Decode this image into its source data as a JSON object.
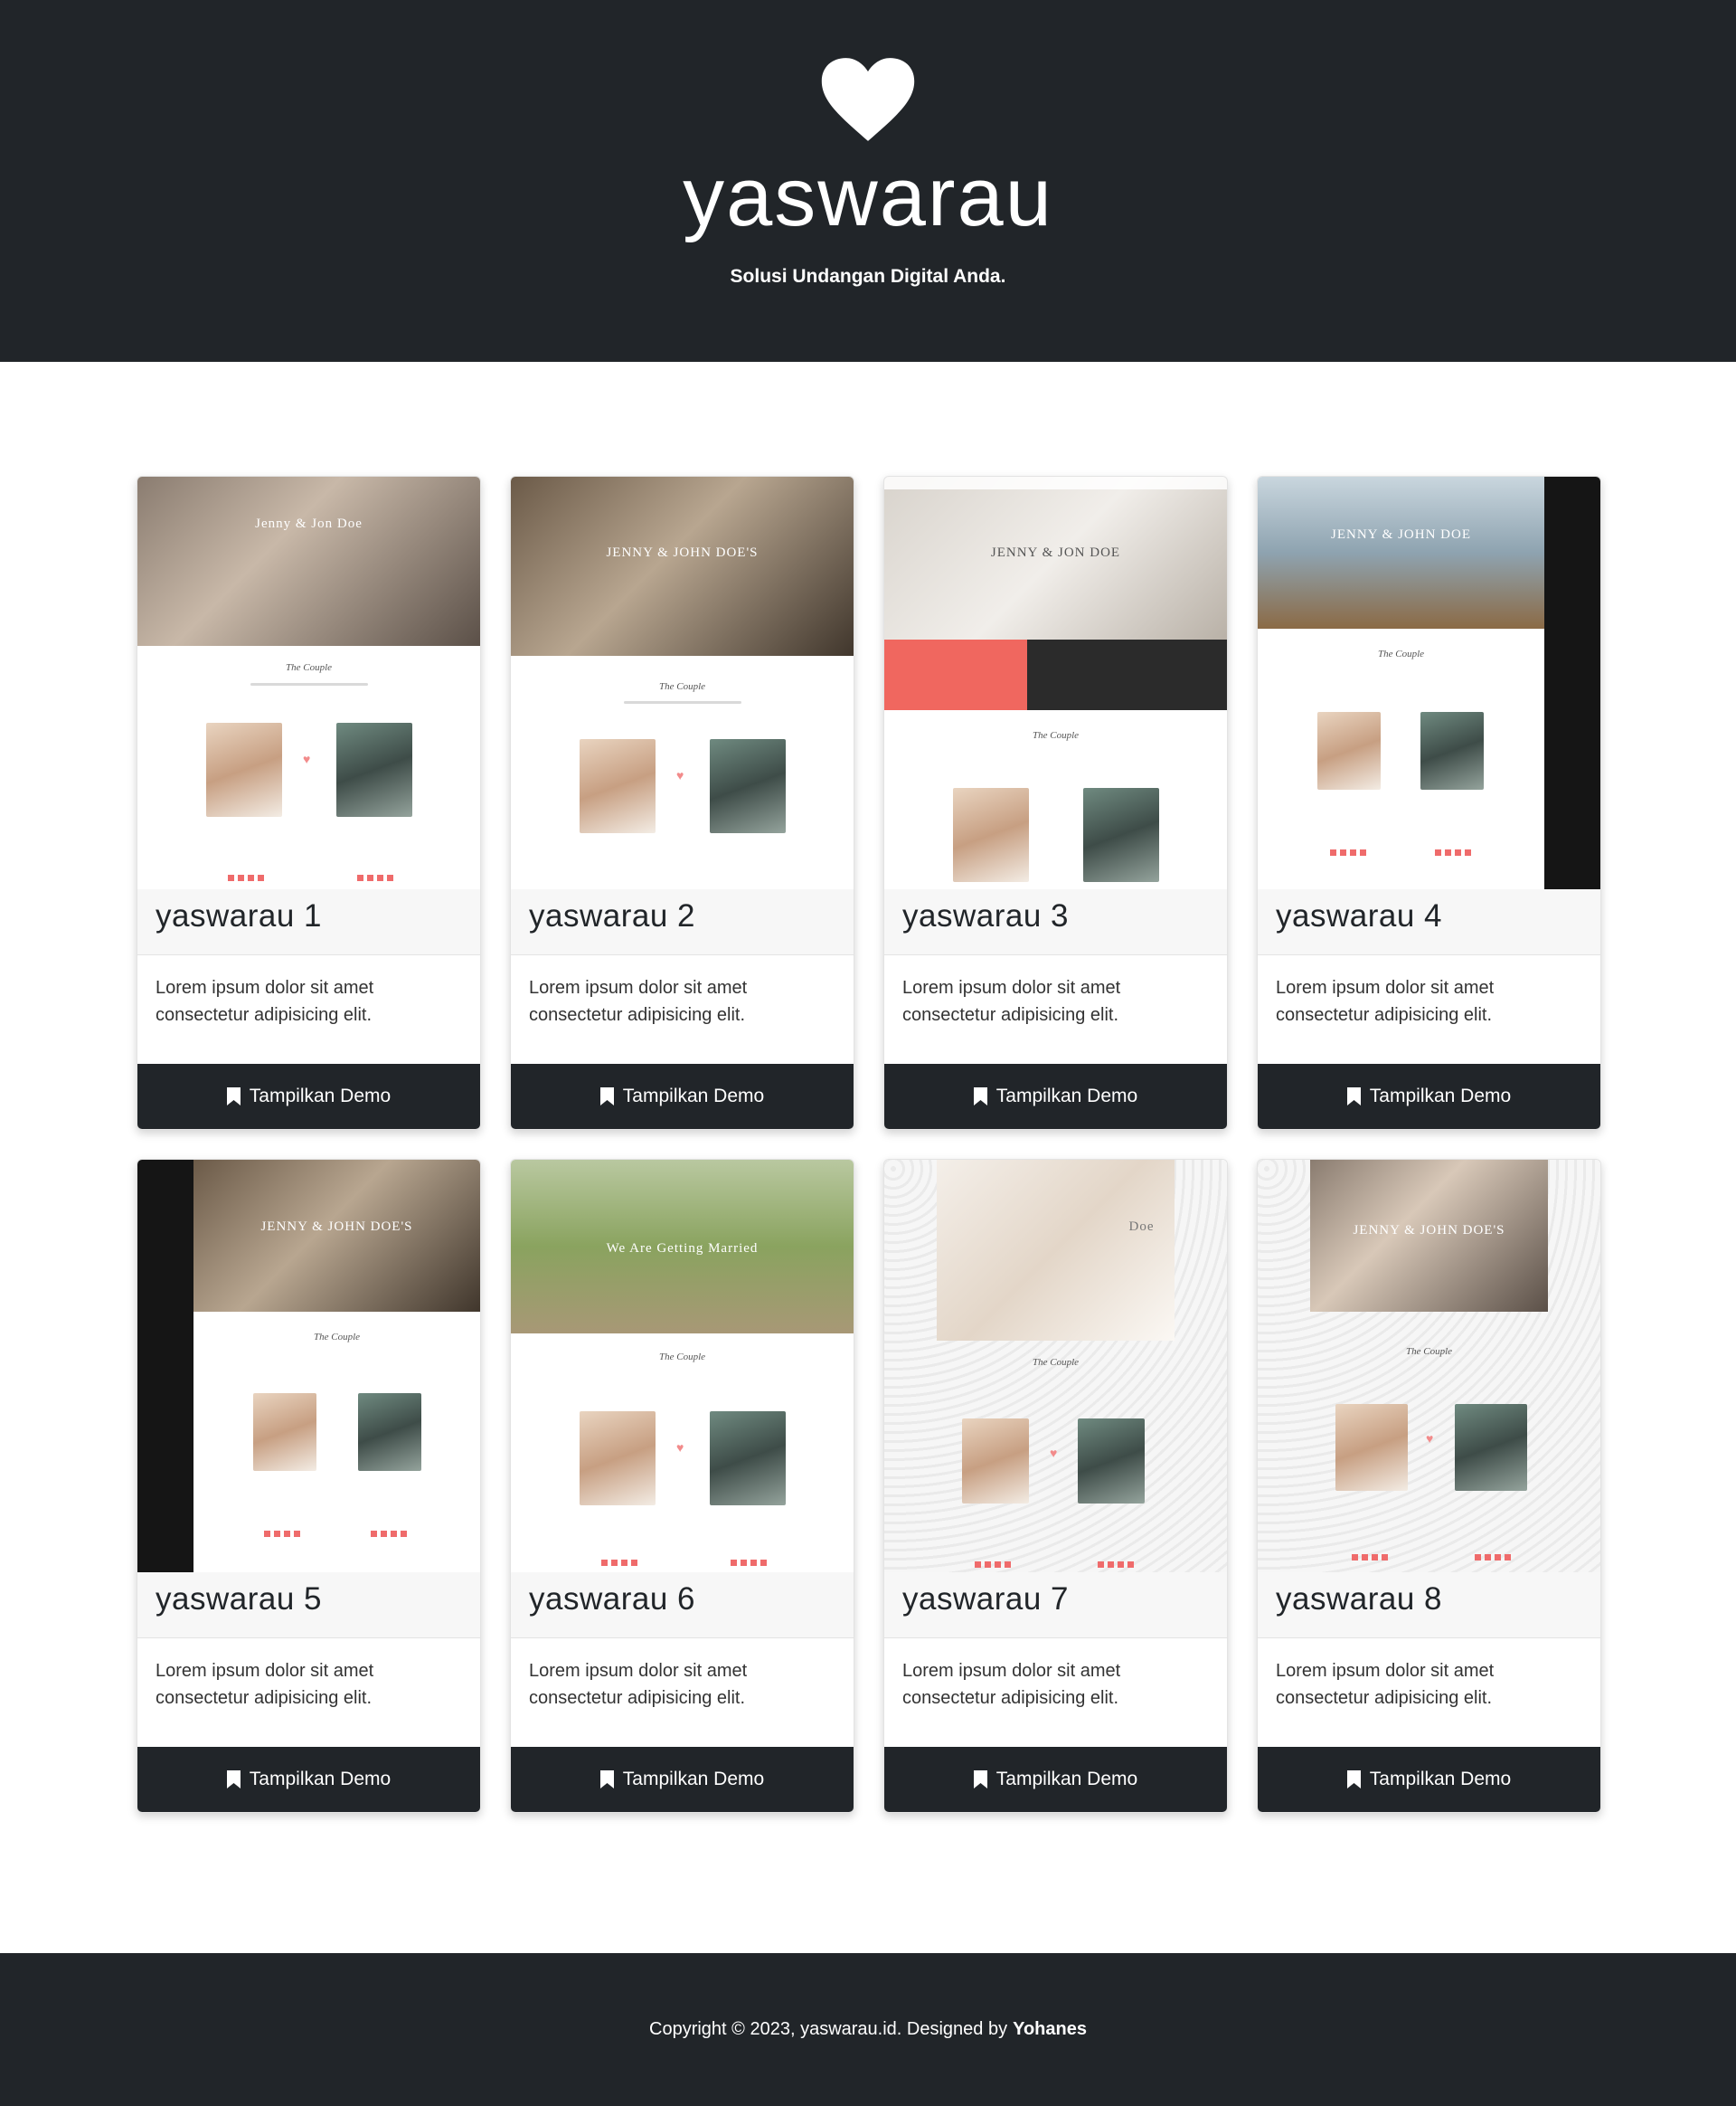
{
  "brand": {
    "name": "yaswarau",
    "tagline": "Solusi Undangan Digital Anda.",
    "icon": "heart-icon"
  },
  "colors": {
    "dark": "#212529",
    "accent": "#f0675f",
    "card_header": "#f7f7f7"
  },
  "cards": [
    {
      "title": "yaswarau 1",
      "text": "Lorem ipsum dolor sit amet consectetur adipisicing elit.",
      "button": "Tampilkan Demo",
      "preview_caption": "Jenny & Jon Doe"
    },
    {
      "title": "yaswarau 2",
      "text": "Lorem ipsum dolor sit amet consectetur adipisicing elit.",
      "button": "Tampilkan Demo",
      "preview_caption": "JENNY & JOHN DOE'S"
    },
    {
      "title": "yaswarau 3",
      "text": "Lorem ipsum dolor sit amet consectetur adipisicing elit.",
      "button": "Tampilkan Demo",
      "preview_caption": "JENNY & JON DOE"
    },
    {
      "title": "yaswarau 4",
      "text": "Lorem ipsum dolor sit amet consectetur adipisicing elit.",
      "button": "Tampilkan Demo",
      "preview_caption": "JENNY & JOHN DOE"
    },
    {
      "title": "yaswarau 5",
      "text": "Lorem ipsum dolor sit amet consectetur adipisicing elit.",
      "button": "Tampilkan Demo",
      "preview_caption": "JENNY & JOHN DOE'S"
    },
    {
      "title": "yaswarau 6",
      "text": "Lorem ipsum dolor sit amet consectetur adipisicing elit.",
      "button": "Tampilkan Demo",
      "preview_caption": "We Are Getting Married"
    },
    {
      "title": "yaswarau 7",
      "text": "Lorem ipsum dolor sit amet consectetur adipisicing elit.",
      "button": "Tampilkan Demo",
      "preview_caption": "Doe"
    },
    {
      "title": "yaswarau 8",
      "text": "Lorem ipsum dolor sit amet consectetur adipisicing elit.",
      "button": "Tampilkan Demo",
      "preview_caption": "JENNY & JOHN DOE'S"
    }
  ],
  "preview": {
    "section_title": "The Couple"
  },
  "footer": {
    "text": "Copyright © 2023, yaswarau.id. Designed by",
    "author": "Yohanes"
  }
}
